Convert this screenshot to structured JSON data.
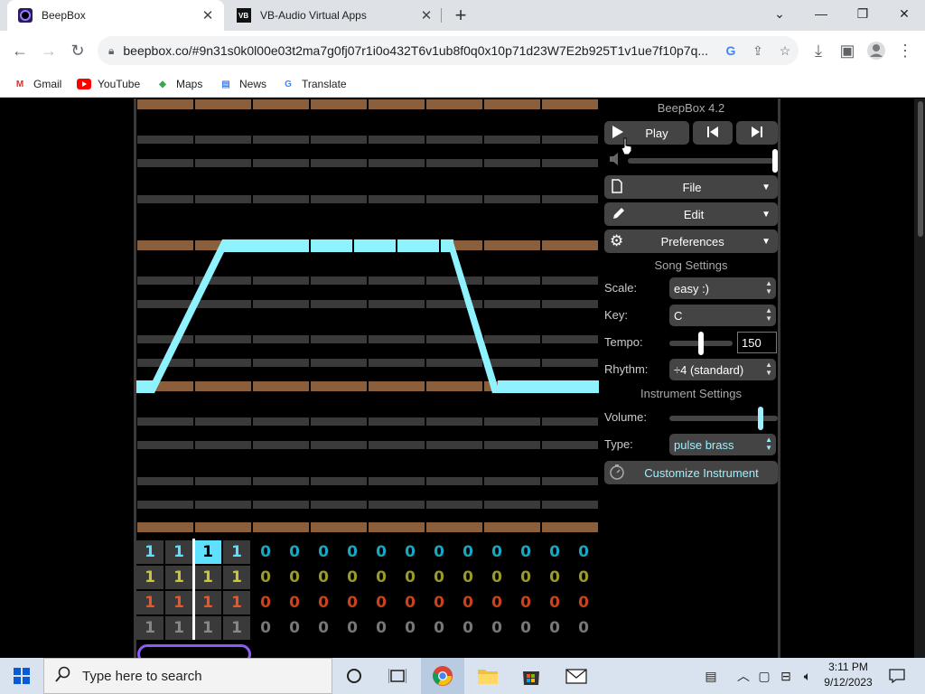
{
  "browser": {
    "tabs": [
      {
        "title": "BeepBox",
        "active": true
      },
      {
        "title": "VB-Audio Virtual Apps",
        "active": false
      }
    ],
    "address": "beepbox.co/#9n31s0k0l00e03t2ma7g0fj07r1i0o432T6v1ub8f0q0x10p71d23W7E2b925T1v1ue7f10p7q...",
    "bookmarks": [
      "Gmail",
      "YouTube",
      "Maps",
      "News",
      "Translate"
    ]
  },
  "beepbox": {
    "title": "BeepBox 4.2",
    "play_label": "Play",
    "file_label": "File",
    "edit_label": "Edit",
    "preferences_label": "Preferences",
    "song_settings_label": "Song Settings",
    "scale_label": "Scale:",
    "scale_value": "easy :)",
    "key_label": "Key:",
    "key_value": "C",
    "tempo_label": "Tempo:",
    "tempo_value": "150",
    "rhythm_label": "Rhythm:",
    "rhythm_value": "÷4 (standard)",
    "instrument_settings_label": "Instrument Settings",
    "volume_label": "Volume:",
    "type_label": "Type:",
    "type_value": "pulse brass",
    "customize_label": "Customize Instrument",
    "tracks": [
      {
        "color": "#5fe0ff",
        "patterns": [
          "1",
          "1",
          "1",
          "1",
          "0",
          "0",
          "0",
          "0",
          "0",
          "0",
          "0",
          "0",
          "0",
          "0",
          "0",
          "0"
        ]
      },
      {
        "color": "#c8c83a",
        "patterns": [
          "1",
          "1",
          "1",
          "1",
          "0",
          "0",
          "0",
          "0",
          "0",
          "0",
          "0",
          "0",
          "0",
          "0",
          "0",
          "0"
        ]
      },
      {
        "color": "#e8562b",
        "patterns": [
          "1",
          "1",
          "1",
          "1",
          "0",
          "0",
          "0",
          "0",
          "0",
          "0",
          "0",
          "0",
          "0",
          "0",
          "0",
          "0"
        ]
      },
      {
        "color": "#8a8a8a",
        "patterns": [
          "1",
          "1",
          "1",
          "1",
          "0",
          "0",
          "0",
          "0",
          "0",
          "0",
          "0",
          "0",
          "0",
          "0",
          "0",
          "0"
        ]
      }
    ]
  },
  "taskbar": {
    "search_placeholder": "Type here to search",
    "time": "3:11 PM",
    "date": "9/12/2023"
  }
}
